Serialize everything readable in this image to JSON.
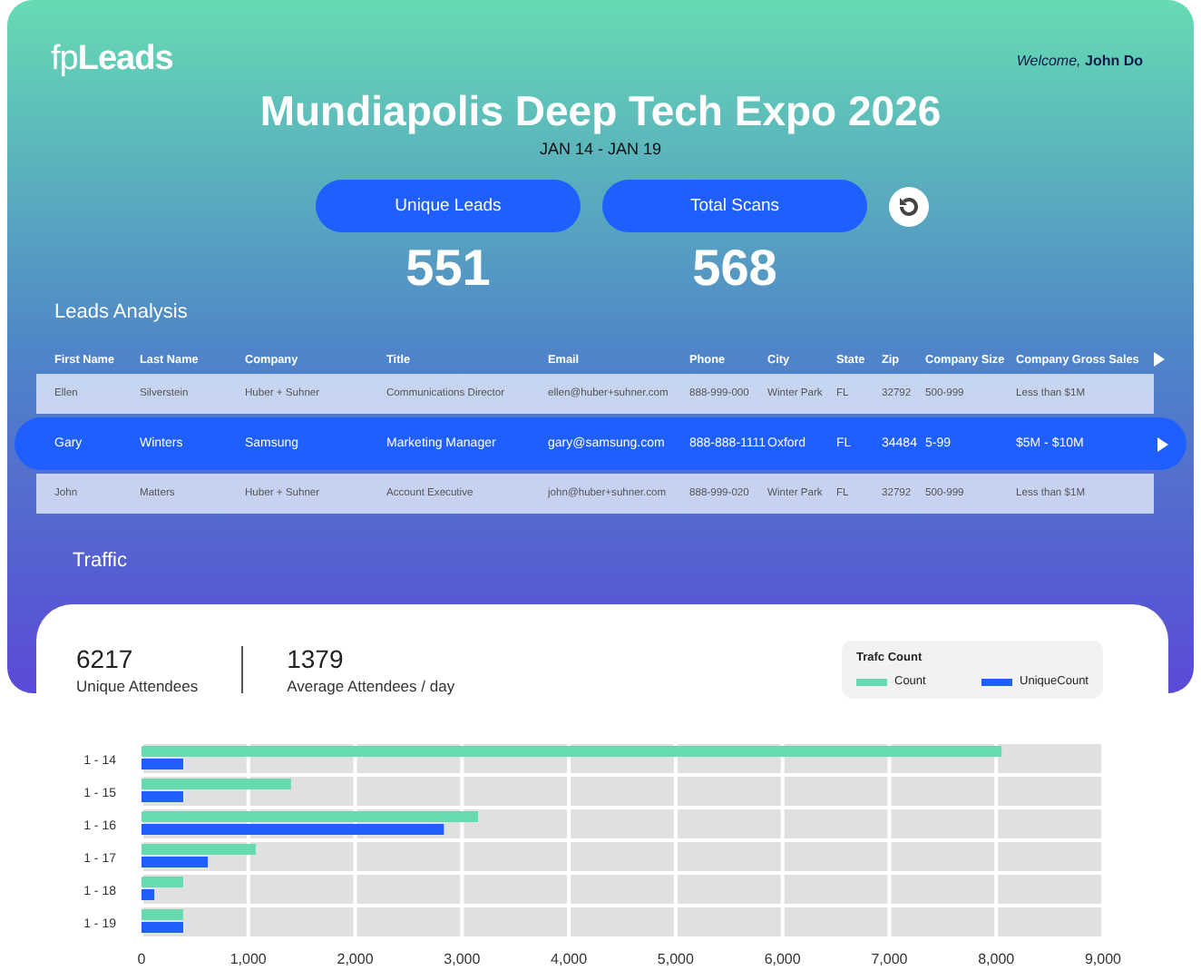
{
  "logo": "fp**Leads**",
  "welcome": "*Welcome,* **John Do**",
  "event": {
    "title": "Mundiapolis Deep Tech Expo 2026",
    "dates": "JAN 14 - JAN 19"
  },
  "stats": [
    {
      "label": "Unique Leads",
      "value": "551"
    },
    {
      "label": "Total Scans",
      "value": "568"
    }
  ],
  "leads_title": "Leads Analysis",
  "table": {
    "columns": [
      "First Name",
      "Last Name",
      "Company",
      "Title",
      "Email",
      "Phone",
      "City",
      "State",
      "Zip",
      "Company Size",
      "Company Gross Sales"
    ],
    "rows": [
      {
        "selected": false,
        "cells": [
          "Ellen",
          "Silverstein",
          "Huber + Suhner",
          "Communications Director",
          "ellen@huber+suhner.com",
          "888-999-000",
          "Winter Park",
          "FL",
          "32792",
          "500-999",
          "Less than $1M"
        ]
      },
      {
        "selected": true,
        "cells": [
          "Gary",
          "Winters",
          "Samsung",
          "Marketing Manager",
          "gary@samsung.com",
          "888-888-1111",
          "Oxford",
          "FL",
          "34484",
          "5-99",
          "$5M - $10M"
        ]
      },
      {
        "selected": false,
        "cells": [
          "John",
          "Matters",
          "Huber + Suhner",
          "Account Executive",
          "john@huber+suhner.com",
          "888-999-020",
          "Winter Park",
          "FL",
          "32792",
          "500-999",
          "Less than $1M"
        ]
      }
    ]
  },
  "traffic": {
    "title": "Traffic",
    "metrics": [
      {
        "value": "6217",
        "label": "Unique Attendees"
      },
      {
        "value": "1379",
        "label": "Average Attendees / day"
      }
    ],
    "legend_title": "Trafc Count",
    "chart_data": {
      "type": "bar",
      "orientation": "horizontal",
      "categories": [
        "1 - 14",
        "1 - 15",
        "1 - 16",
        "1 - 17",
        "1 - 18",
        "1 - 19"
      ],
      "series": [
        {
          "name": "Count",
          "color": "#66dbb0",
          "values": [
            8050,
            1400,
            3150,
            1070,
            390,
            390
          ]
        },
        {
          "name": "UniqueCount",
          "color": "#1f5fff",
          "values": [
            390,
            390,
            2830,
            620,
            120,
            390
          ]
        }
      ],
      "grid": true,
      "xlim": [
        0,
        9000
      ],
      "xticks": [
        {
          "value": 0,
          "label": "0"
        },
        {
          "value": 1000,
          "label": "1,000"
        },
        {
          "value": 2000,
          "label": "2,000"
        },
        {
          "value": 3000,
          "label": "3,000"
        },
        {
          "value": 4000,
          "label": "4,000"
        },
        {
          "value": 5000,
          "label": "5,000"
        },
        {
          "value": 6000,
          "label": "6,000"
        },
        {
          "value": 7000,
          "label": "7,000"
        },
        {
          "value": 8000,
          "label": "8,000"
        },
        {
          "value": 9000,
          "label": "9,000"
        }
      ]
    }
  }
}
